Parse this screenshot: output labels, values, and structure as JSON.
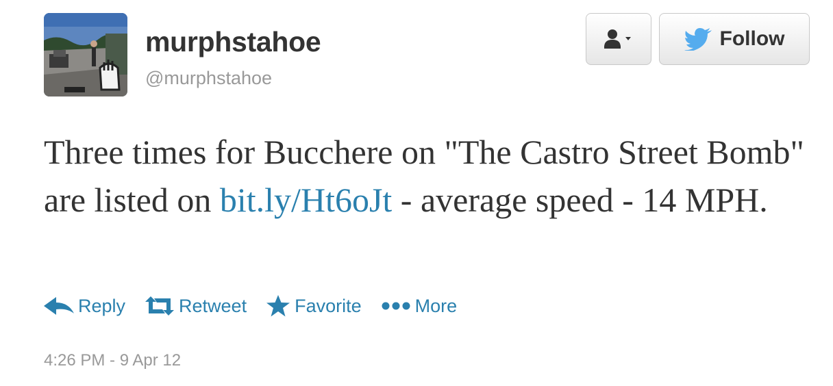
{
  "user": {
    "display_name": "murphstahoe",
    "screen_name": "@murphstahoe"
  },
  "header": {
    "follow_label": "Follow"
  },
  "tweet": {
    "text_before_link": "Three times for Bucchere on \"The Castro Street Bomb\" are listed on ",
    "link_text": "bit.ly/Ht6oJt",
    "text_after_link": " - average speed - 14 MPH."
  },
  "actions": {
    "reply": "Reply",
    "retweet": "Retweet",
    "favorite": "Favorite",
    "more": "More"
  },
  "timestamp": "4:26 PM - 9 Apr 12",
  "colors": {
    "link": "#2a80ae",
    "text": "#333333",
    "muted": "#999999",
    "twitter_bird": "#55acee"
  }
}
